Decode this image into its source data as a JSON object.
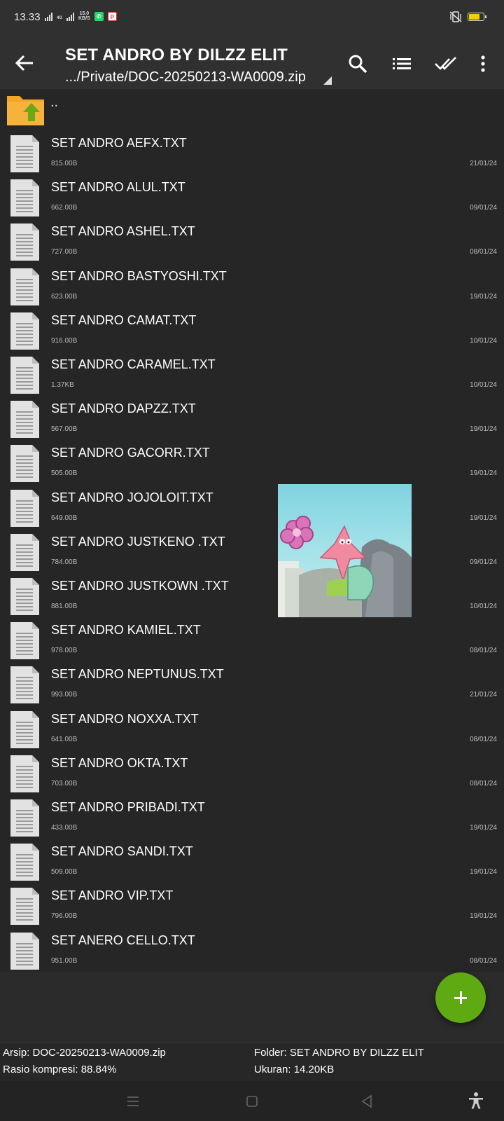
{
  "status": {
    "time": "13.33",
    "network_speed_value": "15.0",
    "network_speed_unit": "KB/S",
    "signal_label": "4G"
  },
  "appbar": {
    "title": "SET ANDRO BY DILZZ ELIT",
    "path": ".../Private/DOC-20250213-WA0009.zip"
  },
  "parent_dir_label": "..",
  "files": [
    {
      "name": "SET ANDRO AEFX.TXT",
      "size": "815.00B",
      "date": "21/01/24"
    },
    {
      "name": "SET ANDRO ALUL.TXT",
      "size": "662.00B",
      "date": "09/01/24"
    },
    {
      "name": "SET ANDRO ASHEL.TXT",
      "size": "727.00B",
      "date": "08/01/24"
    },
    {
      "name": "SET ANDRO BASTYOSHI.TXT",
      "size": "623.00B",
      "date": "19/01/24"
    },
    {
      "name": "SET ANDRO CAMAT.TXT",
      "size": "916.00B",
      "date": "10/01/24"
    },
    {
      "name": "SET ANDRO CARAMEL.TXT",
      "size": "1.37KB",
      "date": "10/01/24"
    },
    {
      "name": "SET ANDRO DAPZZ.TXT",
      "size": "567.00B",
      "date": "19/01/24"
    },
    {
      "name": "SET ANDRO GACORR.TXT",
      "size": "505.00B",
      "date": "19/01/24"
    },
    {
      "name": "SET ANDRO JOJOLOIT.TXT",
      "size": "649.00B",
      "date": "19/01/24"
    },
    {
      "name": "SET ANDRO JUSTKENO .TXT",
      "size": "784.00B",
      "date": "09/01/24"
    },
    {
      "name": "SET ANDRO JUSTKOWN .TXT",
      "size": "881.00B",
      "date": "10/01/24"
    },
    {
      "name": "SET ANDRO KAMIEL.TXT",
      "size": "978.00B",
      "date": "08/01/24"
    },
    {
      "name": "SET ANDRO NEPTUNUS.TXT",
      "size": "993.00B",
      "date": "21/01/24"
    },
    {
      "name": "SET ANDRO NOXXA.TXT",
      "size": "641.00B",
      "date": "08/01/24"
    },
    {
      "name": "SET ANDRO OKTA.TXT",
      "size": "703.00B",
      "date": "08/01/24"
    },
    {
      "name": "SET ANDRO PRIBADI.TXT",
      "size": "433.00B",
      "date": "19/01/24"
    },
    {
      "name": "SET ANDRO SANDI.TXT",
      "size": "509.00B",
      "date": "19/01/24"
    },
    {
      "name": "SET ANDRO VIP.TXT",
      "size": "796.00B",
      "date": "19/01/24"
    },
    {
      "name": "SET ANERO CELLO.TXT",
      "size": "951.00B",
      "date": "08/01/24"
    }
  ],
  "info": {
    "archive": "Arsip: DOC-20250213-WA0009.zip",
    "ratio": "Rasio kompresi: 88.84%",
    "folder": "Folder: SET ANDRO BY DILZZ ELIT",
    "size": "Ukuran: 14.20KB"
  },
  "icons": {
    "back": "arrow-left-icon",
    "search": "search-icon",
    "list": "list-view-icon",
    "select": "double-check-icon",
    "more": "more-vert-icon",
    "fab": "plus-icon"
  },
  "colors": {
    "fab": "#5fa912",
    "folder": "#f5a623",
    "up_arrow": "#6aa816",
    "battery": "#f5d000"
  }
}
